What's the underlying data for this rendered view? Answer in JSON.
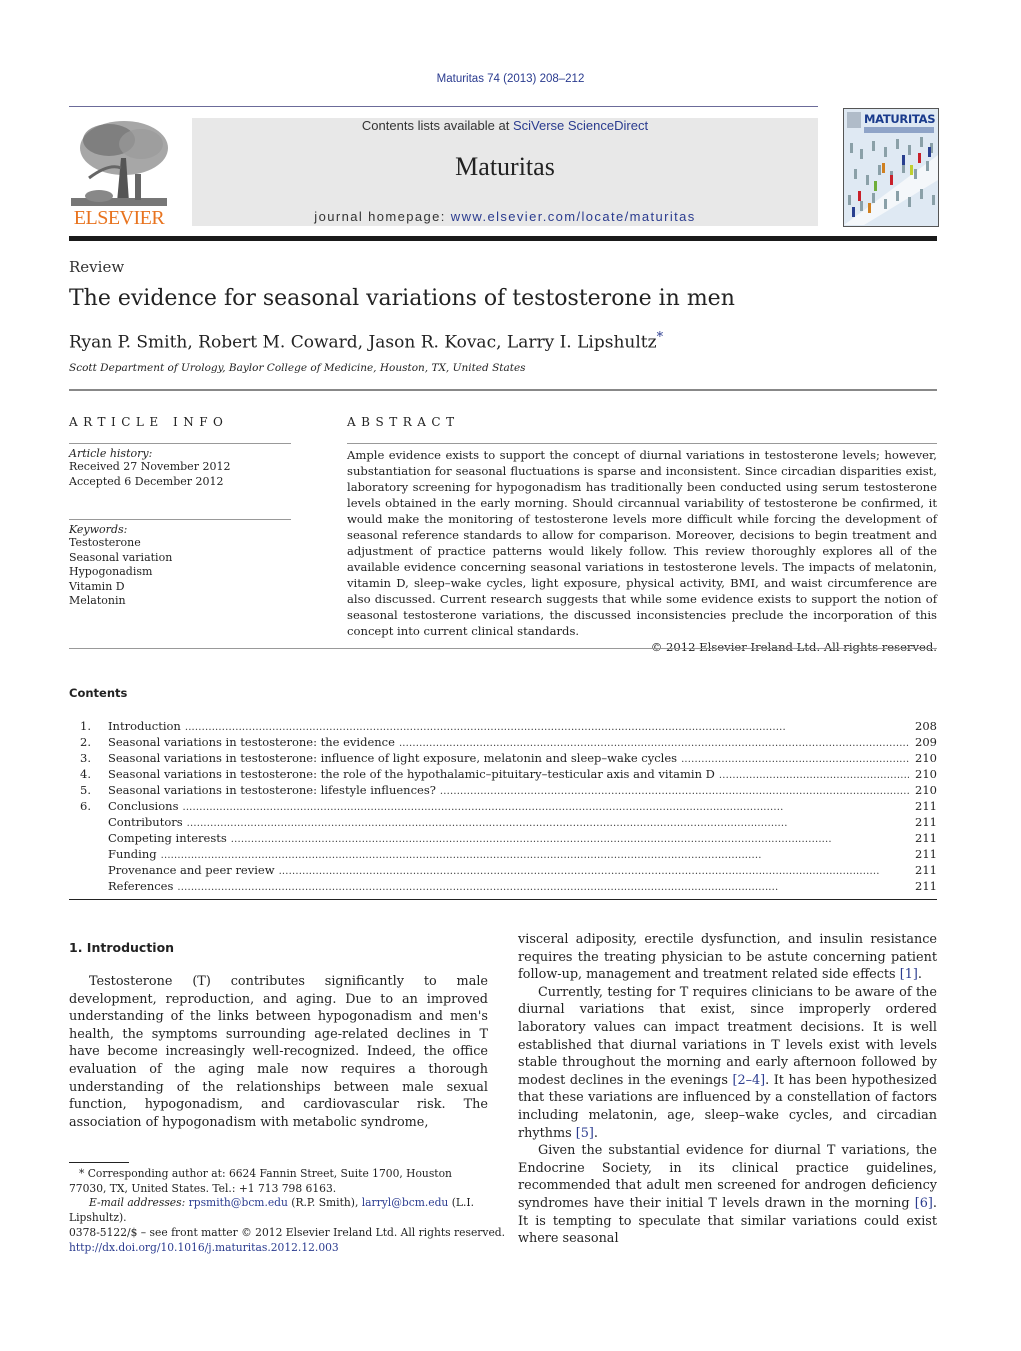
{
  "header": {
    "journal_ref": "Maturitas 74 (2013) 208–212",
    "contents_prefix": "Contents lists available at ",
    "contents_link": "SciVerse ScienceDirect",
    "journal_title": "Maturitas",
    "homepage_prefix": "journal homepage: ",
    "homepage_link": "www.elsevier.com/locate/maturitas",
    "publisher_logo_text": "ELSEVIER",
    "cover_title": "MATURITAS",
    "colors": {
      "publisher_orange": "#e8731e",
      "link_blue": "#2a3b8f",
      "banner_gray": "#e8e8e8"
    }
  },
  "article": {
    "category": "Review",
    "title": "The evidence for seasonal variations of testosterone in men",
    "authors": "Ryan P. Smith, Robert M. Coward, Jason R. Kovac, Larry I. Lipshultz",
    "author_mark": "*",
    "affiliation": "Scott Department of Urology, Baylor College of Medicine, Houston, TX, United States"
  },
  "article_info": {
    "heading": "ARTICLE INFO",
    "history_label": "Article history:",
    "received": "Received 27 November 2012",
    "accepted": "Accepted 6 December 2012",
    "keywords_label": "Keywords:",
    "keywords": [
      "Testosterone",
      "Seasonal variation",
      "Hypogonadism",
      "Vitamin D",
      "Melatonin"
    ]
  },
  "abstract": {
    "heading": "ABSTRACT",
    "text": "Ample evidence exists to support the concept of diurnal variations in testosterone levels; however, substantiation for seasonal fluctuations is sparse and inconsistent. Since circadian disparities exist, laboratory screening for hypogonadism has traditionally been conducted using serum testosterone levels obtained in the early morning. Should circannual variability of testosterone be confirmed, it would make the monitoring of testosterone levels more difficult while forcing the development of seasonal reference standards to allow for comparison. Moreover, decisions to begin treatment and adjustment of practice patterns would likely follow. This review thoroughly explores all of the available evidence concerning seasonal variations in testosterone levels. The impacts of melatonin, vitamin D, sleep–wake cycles, light exposure, physical activity, BMI, and waist circumference are also discussed. Current research suggests that while some evidence exists to support the notion of seasonal testosterone variations, the discussed inconsistencies preclude the incorporation of this concept into current clinical standards.",
    "copyright": "© 2012 Elsevier Ireland Ltd. All rights reserved."
  },
  "contents": {
    "heading": "Contents",
    "items": [
      {
        "num": "1.",
        "label": "Introduction",
        "page": "208"
      },
      {
        "num": "2.",
        "label": "Seasonal variations in testosterone: the evidence",
        "page": "209"
      },
      {
        "num": "3.",
        "label": "Seasonal variations in testosterone: influence of light exposure, melatonin and sleep–wake cycles",
        "page": "210"
      },
      {
        "num": "4.",
        "label": "Seasonal variations in testosterone: the role of the hypothalamic–pituitary–testicular axis and vitamin D",
        "page": "210"
      },
      {
        "num": "5.",
        "label": "Seasonal variations in testosterone: lifestyle influences?",
        "page": "210"
      },
      {
        "num": "6.",
        "label": "Conclusions",
        "page": "211"
      },
      {
        "num": "",
        "label": "Contributors",
        "page": "211"
      },
      {
        "num": "",
        "label": "Competing interests",
        "page": "211"
      },
      {
        "num": "",
        "label": "Funding",
        "page": "211"
      },
      {
        "num": "",
        "label": "Provenance and peer review",
        "page": "211"
      },
      {
        "num": "",
        "label": "References",
        "page": "211"
      }
    ]
  },
  "body": {
    "section_heading": "1.  Introduction",
    "left_para": "Testosterone (T) contributes significantly to male development, reproduction, and aging. Due to an improved understanding of the links between hypogonadism and men's health, the symptoms surrounding age-related declines in T have become increasingly well-recognized. Indeed, the office evaluation of the aging male now requires a thorough understanding of the relationships between male sexual function, hypogonadism, and cardiovascular risk. The association of hypogonadism with metabolic syndrome,",
    "right_p1_text": "visceral adiposity, erectile dysfunction, and insulin resistance requires the treating physician to be astute concerning patient follow-up, management and treatment related side effects ",
    "right_p1_ref": "[1]",
    "right_p2_text_a": "Currently, testing for T requires clinicians to be aware of the diurnal variations that exist, since improperly ordered laboratory values can impact treatment decisions. It is well established that diurnal variations in T levels exist with levels stable throughout the morning and early afternoon followed by modest declines in the evenings ",
    "right_p2_ref_a": "[2–4]",
    "right_p2_text_b": ". It has been hypothesized that these variations are influenced by a constellation of factors including melatonin, age, sleep–wake cycles, and circadian rhythms ",
    "right_p2_ref_b": "[5]",
    "right_p3_text_a": "Given the substantial evidence for diurnal T variations, the Endocrine Society, in its clinical practice guidelines, recommended that adult men screened for androgen deficiency syndromes have their initial T levels drawn in the morning ",
    "right_p3_ref": "[6]",
    "right_p3_text_b": ". It is tempting to speculate that similar variations could exist where seasonal",
    "period": "."
  },
  "footnotes": {
    "corresponding": "* Corresponding author at: 6624 Fannin Street, Suite 1700, Houston 77030, TX, United States. Tel.: +1 713 798 6163.",
    "email_label": "E-mail addresses: ",
    "email1": "rpsmith@bcm.edu",
    "email1_name": " (R.P. Smith), ",
    "email2": "larryl@bcm.edu",
    "email2_name": " (L.I. Lipshultz).",
    "front_matter": "0378-5122/$ – see front matter © 2012 Elsevier Ireland Ltd. All rights reserved.",
    "doi": "http://dx.doi.org/10.1016/j.maturitas.2012.12.003"
  }
}
